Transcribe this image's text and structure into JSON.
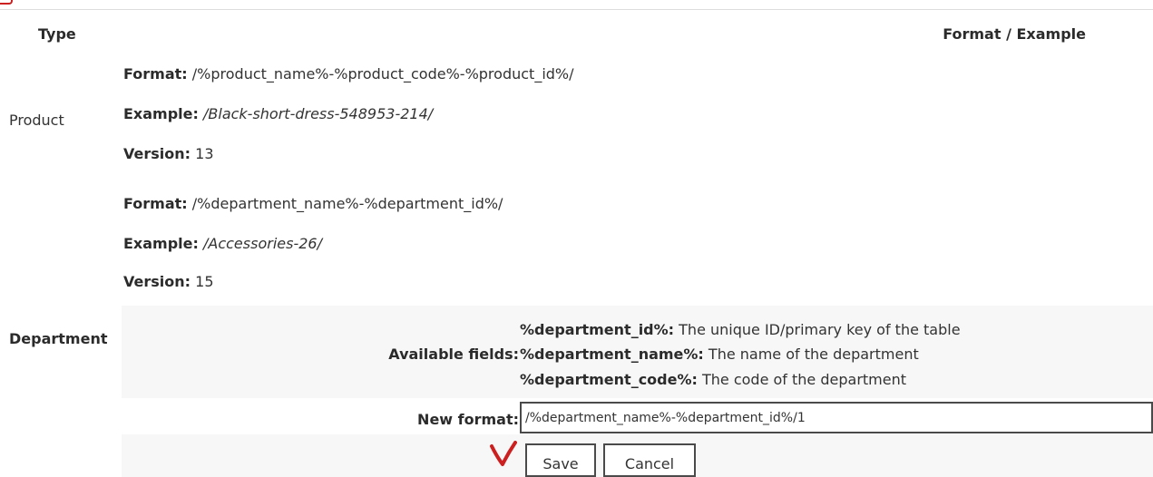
{
  "table": {
    "header_type": "Type",
    "header_format": "Format / Example"
  },
  "product": {
    "type_label": "Product",
    "format_label": "Format:",
    "format_value": "/%product_name%-%product_code%-%product_id%/",
    "example_label": "Example:",
    "example_value": "/Black-short-dress-548953-214/",
    "version_label": "Version:",
    "version_value": "13"
  },
  "department": {
    "type_label": "Department",
    "format_label": "Format:",
    "format_value": "/%department_name%-%department_id%/",
    "example_label": "Example:",
    "example_value": "/Accessories-26/",
    "version_label": "Version:",
    "version_value": "15",
    "available_fields_label": "Available fields:",
    "fields": [
      {
        "name": "%department_id%:",
        "description": " The unique ID/primary key of the table"
      },
      {
        "name": "%department_name%:",
        "description": " The name of the department"
      },
      {
        "name": "%department_code%:",
        "description": " The code of the department"
      }
    ],
    "new_format_label": "New format:",
    "new_format_value": "/%department_name%-%department_id%/1",
    "save_label": "Save",
    "cancel_label": "Cancel"
  },
  "colors": {
    "accent_red": "#cc1f1f",
    "panel_bg": "#f7f7f7",
    "text": "#333333"
  },
  "icons": {
    "annotation": "red-checkmark-icon"
  }
}
